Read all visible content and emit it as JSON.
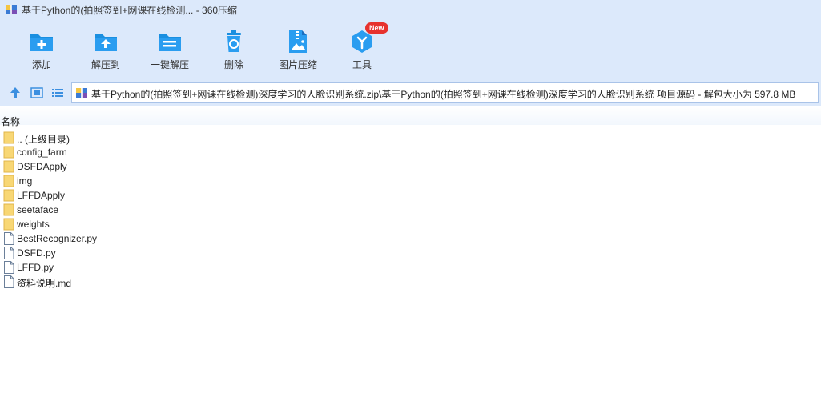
{
  "window": {
    "title": "基于Python的(拍照签到+网课在线检测... - 360压缩",
    "app_icon": "archive-icon"
  },
  "toolbar": {
    "items": [
      {
        "label": "添加",
        "icon": "add-file-icon"
      },
      {
        "label": "解压到",
        "icon": "extract-to-icon"
      },
      {
        "label": "一键解压",
        "icon": "one-click-extract-icon"
      },
      {
        "label": "删除",
        "icon": "trash-icon"
      },
      {
        "label": "图片压缩",
        "icon": "image-compress-icon"
      },
      {
        "label": "工具",
        "icon": "tools-icon",
        "badge": "New"
      }
    ]
  },
  "navbar": {
    "path": "基于Python的(拍照签到+网课在线检测)深度学习的人脸识别系统.zip\\基于Python的(拍照签到+网课在线检测)深度学习的人脸识别系统 项目源码 - 解包大小为 597.8 MB"
  },
  "list": {
    "column_name": "名称",
    "items": [
      {
        "name": ".. (上级目录)",
        "type": "folder"
      },
      {
        "name": "config_farm",
        "type": "folder"
      },
      {
        "name": "DSFDApply",
        "type": "folder"
      },
      {
        "name": "img",
        "type": "folder"
      },
      {
        "name": "LFFDApply",
        "type": "folder"
      },
      {
        "name": "seetaface",
        "type": "folder"
      },
      {
        "name": "weights",
        "type": "folder"
      },
      {
        "name": "BestRecognizer.py",
        "type": "file"
      },
      {
        "name": "DSFD.py",
        "type": "file"
      },
      {
        "name": "LFFD.py",
        "type": "file"
      },
      {
        "name": "资料说明.md",
        "type": "file"
      }
    ]
  },
  "colors": {
    "chrome_bg": "#dce9fb",
    "icon_blue": "#1a8fe0",
    "folder_yellow": "#f8d775",
    "badge_red": "#e7322e"
  }
}
